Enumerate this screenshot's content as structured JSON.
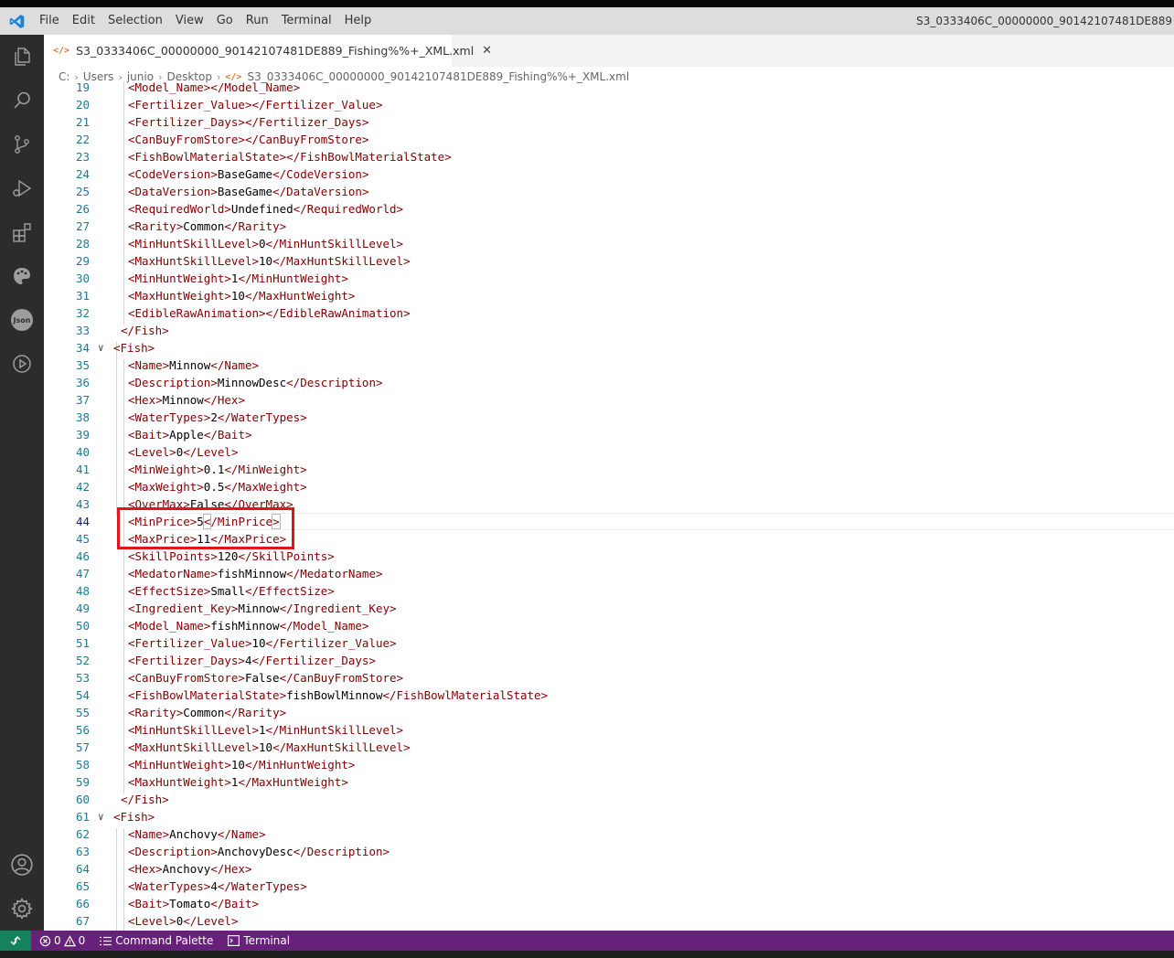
{
  "menu": [
    "File",
    "Edit",
    "Selection",
    "View",
    "Go",
    "Run",
    "Terminal",
    "Help"
  ],
  "window_title": "S3_0333406C_00000000_90142107481DE889",
  "tab": {
    "icon": "</>",
    "label": "S3_0333406C_00000000_90142107481DE889_Fishing%%+_XML.xml",
    "close": "✕"
  },
  "breadcrumb": [
    "C:",
    "Users",
    "junio",
    "Desktop",
    "S3_0333406C_00000000_90142107481DE889_Fishing%%+_XML.xml"
  ],
  "breadcrumb_icon": "</>",
  "activity_icons": [
    "explorer-icon",
    "search-icon",
    "source-control-icon",
    "run-debug-icon",
    "extensions-icon",
    "palette-icon",
    "json-icon",
    "play-circle-icon",
    "account-icon",
    "gear-icon"
  ],
  "json_badge": "Json",
  "code_lines": [
    {
      "n": "19",
      "tag": "Model_Name",
      "value": ""
    },
    {
      "n": "20",
      "tag": "Fertilizer_Value",
      "value": ""
    },
    {
      "n": "21",
      "tag": "Fertilizer_Days",
      "value": ""
    },
    {
      "n": "22",
      "tag": "CanBuyFromStore",
      "value": ""
    },
    {
      "n": "23",
      "tag": "FishBowlMaterialState",
      "value": ""
    },
    {
      "n": "24",
      "tag": "CodeVersion",
      "value": "BaseGame"
    },
    {
      "n": "25",
      "tag": "DataVersion",
      "value": "BaseGame"
    },
    {
      "n": "26",
      "tag": "RequiredWorld",
      "value": "Undefined"
    },
    {
      "n": "27",
      "tag": "Rarity",
      "value": "Common"
    },
    {
      "n": "28",
      "tag": "MinHuntSkillLevel",
      "value": "0"
    },
    {
      "n": "29",
      "tag": "MaxHuntSkillLevel",
      "value": "10"
    },
    {
      "n": "30",
      "tag": "MinHuntWeight",
      "value": "1"
    },
    {
      "n": "31",
      "tag": "MaxHuntWeight",
      "value": "10"
    },
    {
      "n": "32",
      "tag": "EdibleRawAnimation",
      "value": ""
    },
    {
      "n": "33",
      "close": "Fish"
    },
    {
      "n": "34",
      "open": "Fish"
    },
    {
      "n": "35",
      "tag": "Name",
      "value": "Minnow"
    },
    {
      "n": "36",
      "tag": "Description",
      "value": "MinnowDesc"
    },
    {
      "n": "37",
      "tag": "Hex",
      "value": "Minnow"
    },
    {
      "n": "38",
      "tag": "WaterTypes",
      "value": "2"
    },
    {
      "n": "39",
      "tag": "Bait",
      "value": "Apple"
    },
    {
      "n": "40",
      "tag": "Level",
      "value": "0"
    },
    {
      "n": "41",
      "tag": "MinWeight",
      "value": "0.1"
    },
    {
      "n": "42",
      "tag": "MaxWeight",
      "value": "0.5"
    },
    {
      "n": "43",
      "tag": "OverMax",
      "value": "False"
    },
    {
      "n": "44",
      "tag": "MinPrice",
      "value": "5"
    },
    {
      "n": "45",
      "tag": "MaxPrice",
      "value": "11"
    },
    {
      "n": "46",
      "tag": "SkillPoints",
      "value": "120"
    },
    {
      "n": "47",
      "tag": "MedatorName",
      "value": "fishMinnow"
    },
    {
      "n": "48",
      "tag": "EffectSize",
      "value": "Small"
    },
    {
      "n": "49",
      "tag": "Ingredient_Key",
      "value": "Minnow"
    },
    {
      "n": "50",
      "tag": "Model_Name",
      "value": "fishMinnow"
    },
    {
      "n": "51",
      "tag": "Fertilizer_Value",
      "value": "10"
    },
    {
      "n": "52",
      "tag": "Fertilizer_Days",
      "value": "4"
    },
    {
      "n": "53",
      "tag": "CanBuyFromStore",
      "value": "False"
    },
    {
      "n": "54",
      "tag": "FishBowlMaterialState",
      "value": "fishBowlMinnow"
    },
    {
      "n": "55",
      "tag": "Rarity",
      "value": "Common"
    },
    {
      "n": "56",
      "tag": "MinHuntSkillLevel",
      "value": "1"
    },
    {
      "n": "57",
      "tag": "MaxHuntSkillLevel",
      "value": "10"
    },
    {
      "n": "58",
      "tag": "MinHuntWeight",
      "value": "10"
    },
    {
      "n": "59",
      "tag": "MaxHuntWeight",
      "value": "1"
    },
    {
      "n": "60",
      "close": "Fish"
    },
    {
      "n": "61",
      "open": "Fish"
    },
    {
      "n": "62",
      "tag": "Name",
      "value": "Anchovy"
    },
    {
      "n": "63",
      "tag": "Description",
      "value": "AnchovyDesc"
    },
    {
      "n": "64",
      "tag": "Hex",
      "value": "Anchovy"
    },
    {
      "n": "65",
      "tag": "WaterTypes",
      "value": "4"
    },
    {
      "n": "66",
      "tag": "Bait",
      "value": "Tomato"
    },
    {
      "n": "67",
      "tag": "Level",
      "value": "0"
    }
  ],
  "active_line": "44",
  "status": {
    "errors": "0",
    "warnings": "0",
    "command_palette": "Command Palette",
    "terminal": "Terminal"
  },
  "colors": {
    "tag": "#800000",
    "text": "#000000",
    "line_number": "#237893",
    "status_bar": "#68217a",
    "remote": "#16825d",
    "highlight_box": "#e0151a",
    "activity_bar": "#2c2c2c"
  }
}
